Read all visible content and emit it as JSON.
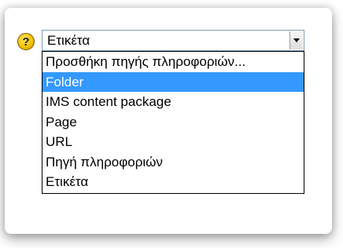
{
  "select": {
    "value": "Ετικέτα",
    "help_icon_symbol": "?",
    "help_icon_name": "help-icon",
    "arrow_icon_name": "chevron-down-icon"
  },
  "dropdown": {
    "options": [
      {
        "label": "Προσθήκη πηγής πληροφοριών...",
        "selected": false
      },
      {
        "label": "Folder",
        "selected": true
      },
      {
        "label": "IMS content package",
        "selected": false
      },
      {
        "label": "Page",
        "selected": false
      },
      {
        "label": "URL",
        "selected": false
      },
      {
        "label": "Πηγή πληροφοριών",
        "selected": false
      },
      {
        "label": "Ετικέτα",
        "selected": false
      }
    ]
  },
  "colors": {
    "highlight": "#3399ff",
    "help_icon": "#f3c300",
    "border": "#7f9db9"
  }
}
